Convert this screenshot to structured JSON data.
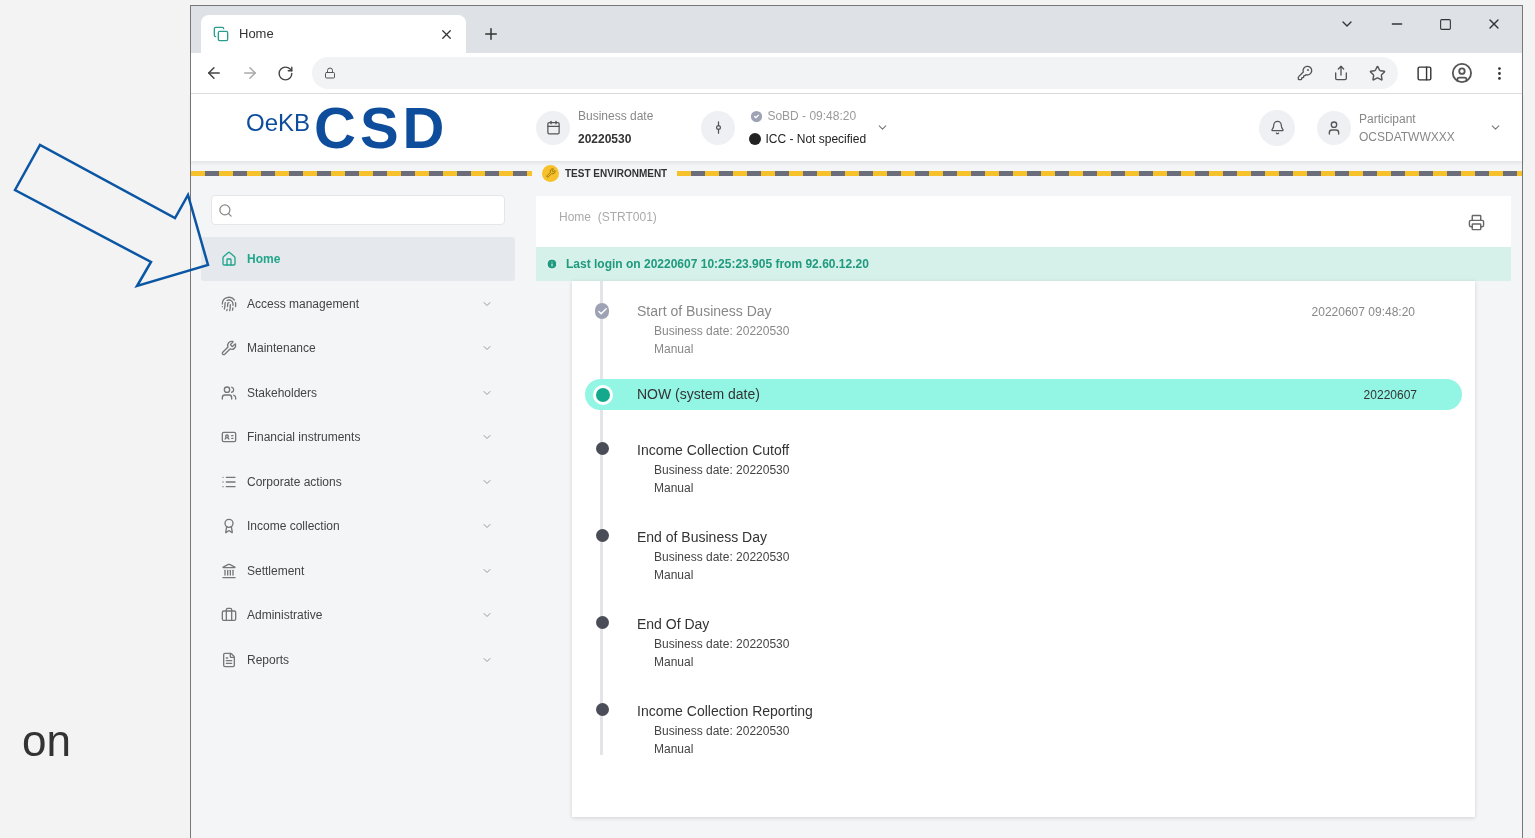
{
  "slide": {
    "fragment": "on"
  },
  "browser": {
    "tab": {
      "title": "Home"
    }
  },
  "app": {
    "logo": {
      "small": "OeKB",
      "large": "CSD"
    },
    "header": {
      "business_date_label": "Business date",
      "business_date": "20220530",
      "status_line": "SoBD - 09:48:20",
      "status_done": true,
      "icc": "ICC - Not specified",
      "user_role": "Participant",
      "user_id": "OCSDATWWXXX"
    },
    "environment_banner": "TEST ENVIRONMENT",
    "sidebar": {
      "items": [
        {
          "label": "Home",
          "selected": true,
          "expandable": false
        },
        {
          "label": "Access management",
          "selected": false,
          "expandable": true
        },
        {
          "label": "Maintenance",
          "selected": false,
          "expandable": true
        },
        {
          "label": "Stakeholders",
          "selected": false,
          "expandable": true
        },
        {
          "label": "Financial instruments",
          "selected": false,
          "expandable": true
        },
        {
          "label": "Corporate actions",
          "selected": false,
          "expandable": true
        },
        {
          "label": "Income collection",
          "selected": false,
          "expandable": true
        },
        {
          "label": "Settlement",
          "selected": false,
          "expandable": true
        },
        {
          "label": "Administrative",
          "selected": false,
          "expandable": true
        },
        {
          "label": "Reports",
          "selected": false,
          "expandable": true
        }
      ]
    },
    "breadcrumb": {
      "page": "Home",
      "code": "(STRT001)"
    },
    "notice": "Last login on 20220607 10:25:23.905 from 92.60.12.20",
    "timeline": [
      {
        "kind": "done",
        "title": "Start of Business Day",
        "details": [
          "Business date: 20220530",
          "Manual"
        ],
        "time": "20220607 09:48:20"
      },
      {
        "kind": "now",
        "title": "NOW (system date)",
        "time": "20220607"
      },
      {
        "kind": "pending",
        "title": "Income Collection Cutoff",
        "details": [
          "Business date: 20220530",
          "Manual"
        ]
      },
      {
        "kind": "pending",
        "title": "End of Business Day",
        "details": [
          "Business date: 20220530",
          "Manual"
        ]
      },
      {
        "kind": "pending",
        "title": "End Of Day",
        "details": [
          "Business date: 20220530",
          "Manual"
        ]
      },
      {
        "kind": "pending",
        "title": "Income Collection Reporting",
        "details": [
          "Business date: 20220530",
          "Manual"
        ]
      }
    ]
  }
}
